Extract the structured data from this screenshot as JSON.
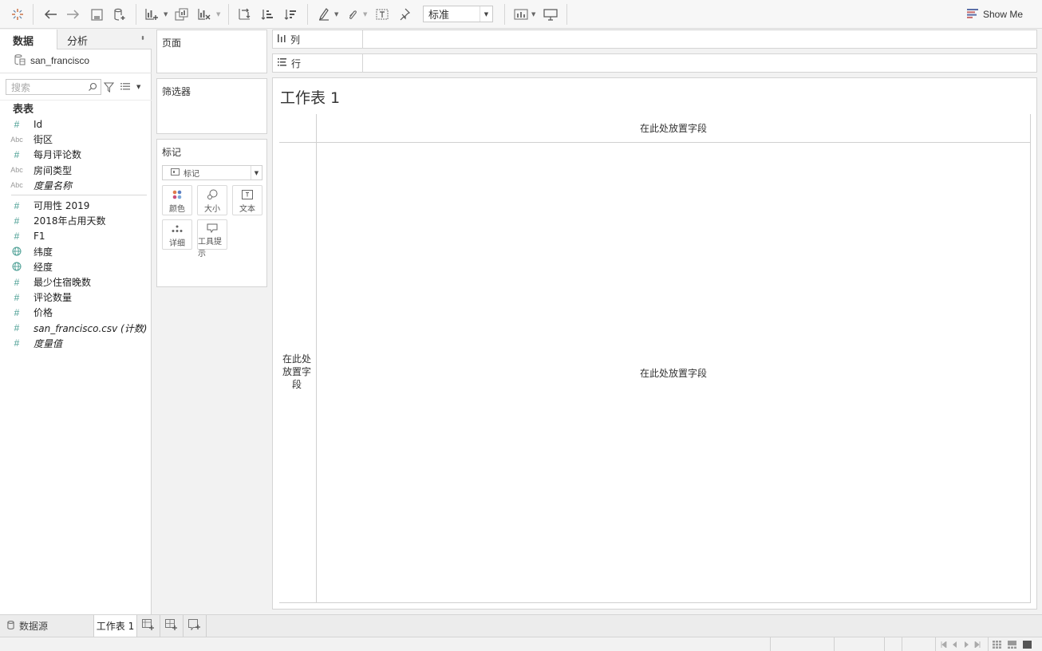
{
  "toolbar": {
    "fit_value": "标准",
    "show_me_label": "Show Me",
    "icons": [
      "tableau-logo-icon",
      "undo-icon",
      "redo-icon",
      "save-icon",
      "new-datasource-icon",
      "new-worksheet-icon",
      "duplicate-sheet-icon",
      "clear-sheet-icon",
      "swap-icon",
      "sort-ascending-icon",
      "sort-descending-icon",
      "highlight-icon",
      "group-icon",
      "labels-icon",
      "pin-icon",
      "fit-dropdown",
      "view-cards-icon",
      "presentation-icon",
      "show-me-icon"
    ]
  },
  "left_panel": {
    "tab_data": "数据",
    "tab_analysis": "分析",
    "datasource_name": "san_francisco",
    "search_placeholder": "搜索",
    "tables_header": "表表",
    "fields": [
      {
        "type": "#",
        "label": "Id",
        "italic": false
      },
      {
        "type": "Abc",
        "label": "街区",
        "italic": false
      },
      {
        "type": "#",
        "label": "每月评论数",
        "italic": false
      },
      {
        "type": "Abc",
        "label": "房间类型",
        "italic": false
      },
      {
        "type": "Abc",
        "label": "度量名称",
        "italic": true
      },
      {
        "type": "#",
        "label": "可用性 2019",
        "italic": false
      },
      {
        "type": "#",
        "label": "2018年占用天数",
        "italic": false
      },
      {
        "type": "#",
        "label": "F1",
        "italic": false
      },
      {
        "type": "globe",
        "label": "纬度",
        "italic": false
      },
      {
        "type": "globe",
        "label": "经度",
        "italic": false
      },
      {
        "type": "#",
        "label": "最少住宿晚数",
        "italic": false
      },
      {
        "type": "#",
        "label": "评论数量",
        "italic": false
      },
      {
        "type": "#",
        "label": "价格",
        "italic": false
      },
      {
        "type": "#",
        "label": "san_francisco.csv (计数)",
        "italic": true
      },
      {
        "type": "#",
        "label": "度量值",
        "italic": true
      }
    ]
  },
  "cards": {
    "pages_title": "页面",
    "filters_title": "筛选器",
    "marks_title": "标记",
    "mark_type": "标记",
    "mark_buttons": [
      {
        "icon": "color-icon",
        "label": "颜色"
      },
      {
        "icon": "size-icon",
        "label": "大小"
      },
      {
        "icon": "text-icon",
        "label": "文本"
      },
      {
        "icon": "detail-icon",
        "label": "详细"
      },
      {
        "icon": "tooltip-icon",
        "label": "工具提示"
      }
    ]
  },
  "shelves": {
    "columns_label": "列",
    "rows_label": "行"
  },
  "view": {
    "sheet_title": "工作表 1",
    "drop_top": "在此处放置字段",
    "drop_left": "在此处放置字段",
    "drop_center": "在此处放置字段"
  },
  "bottom": {
    "datasource_tab": "数据源",
    "sheet_tab": "工作表 1"
  },
  "colors": {
    "measure_teal": "#4a9e93",
    "panel_bg": "#f2f2f2",
    "border": "#d4d4d4"
  }
}
